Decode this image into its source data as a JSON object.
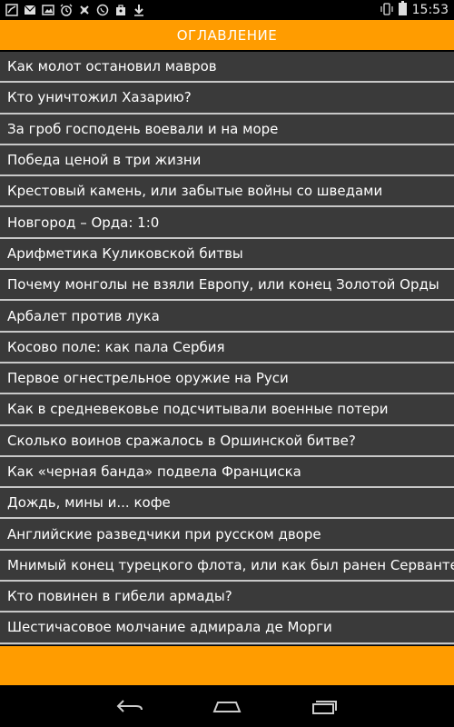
{
  "status_bar": {
    "time": "15:53",
    "icons": [
      "notification-icon",
      "mail-icon",
      "gallery-icon",
      "alarm-icon",
      "sync-icon",
      "viber-icon",
      "bag-icon",
      "download-icon",
      "vibrate-icon",
      "battery-icon"
    ]
  },
  "header": {
    "title": "ОГЛАВЛЕНИЕ"
  },
  "colors": {
    "accent": "#ff9c00",
    "list_background": "#3a3a3a",
    "divider": "#c8c8c8",
    "text": "#ffffff"
  },
  "chapters": [
    "Как молот остановил мавров",
    "Кто уничтожил Хазарию?",
    "За гроб господень воевали и на море",
    "Победа ценой в три жизни",
    "Крестовый камень, или забытые войны со шведами",
    "Новгород – Орда: 1:0",
    "Арифметика Куликовской битвы",
    "Почему монголы не взяли Европу, или конец Золотой Орды",
    "Арбалет против лука",
    "Косово поле: как пала Сербия",
    "Первое огнестрельное оружие на Руси",
    "Как в средневековье подсчитывали военные потери",
    "Сколько воинов сражалось в Оршинской битве?",
    "Как «черная банда» подвела Франциска",
    "Дождь, мины и... кофе",
    "Английские разведчики при русском дворе",
    "Мнимый конец турецкого флота, или как был ранен Сервантес",
    "Кто повинен в гибели армады?",
    "Шестичасовое молчание адмирала де Морги"
  ],
  "nav_bar": {
    "buttons": [
      "back-icon",
      "home-icon",
      "recent-apps-icon"
    ]
  }
}
